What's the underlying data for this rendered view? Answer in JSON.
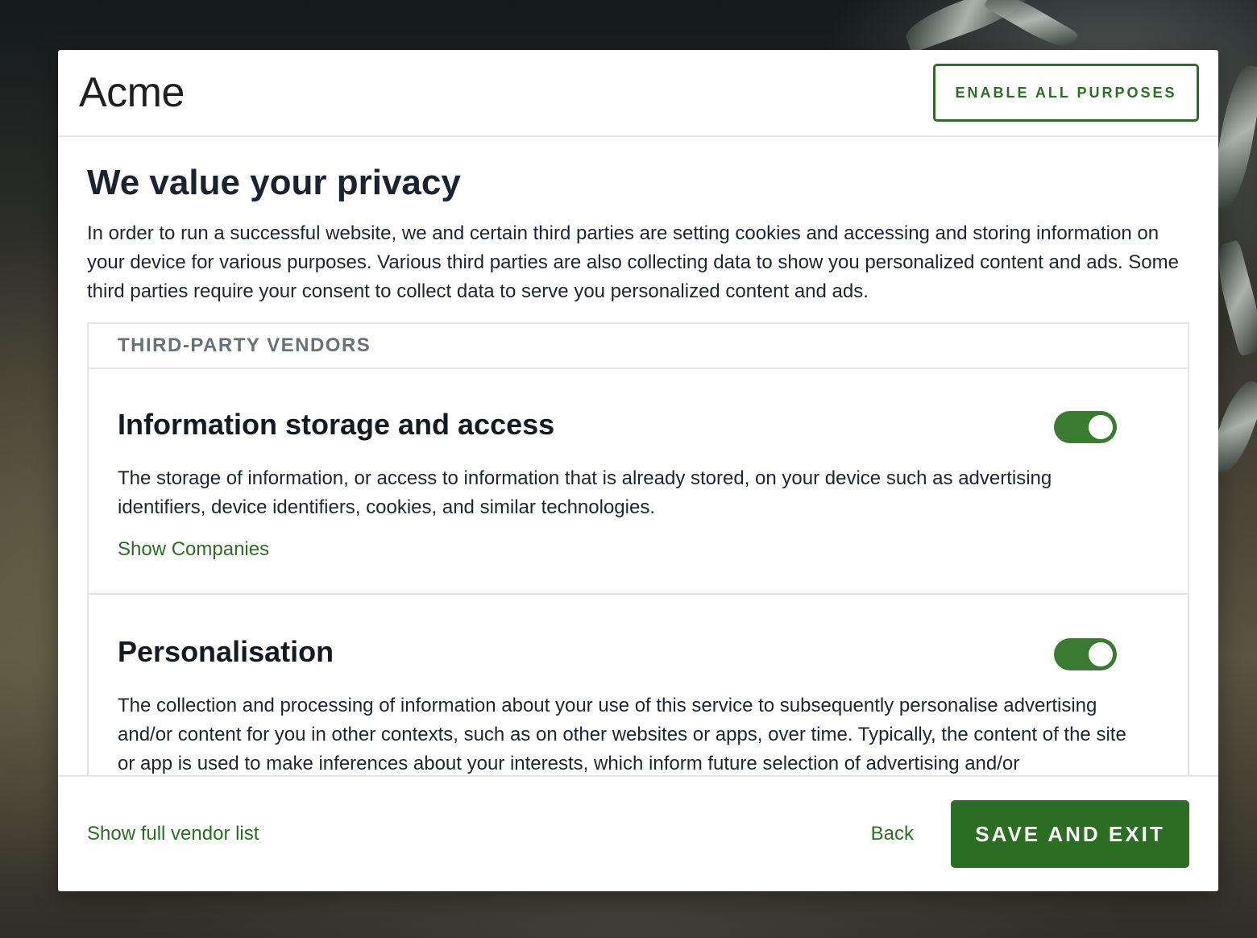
{
  "header": {
    "brand": "Acme",
    "enable_all_label": "ENABLE ALL PURPOSES"
  },
  "main": {
    "title": "We value your privacy",
    "intro": "In order to run a successful website, we and certain third parties are setting cookies and accessing and storing information on your device for various purposes. Various third parties are also collecting data to show you personalized content and ads. Some third parties require your consent to collect data to serve you personalized content and ads.",
    "section_heading": "THIRD-PARTY VENDORS",
    "purposes": [
      {
        "title": "Information storage and access",
        "description": "The storage of information, or access to information that is already stored, on your device such as advertising identifiers, device identifiers, cookies, and similar technologies.",
        "link": "Show Companies",
        "enabled": true
      },
      {
        "title": "Personalisation",
        "description": "The collection and processing of information about your use of this service to subsequently personalise advertising and/or content for you in other contexts, such as on other websites or apps, over time. Typically, the content of the site or app is used to make inferences about your interests, which inform future selection of advertising and/or",
        "enabled": true
      }
    ]
  },
  "footer": {
    "vendor_list_label": "Show full vendor list",
    "back_label": "Back",
    "save_label": "SAVE AND EXIT"
  },
  "colors": {
    "accent": "#2b6d22",
    "toggle_on": "#3a7a31"
  }
}
